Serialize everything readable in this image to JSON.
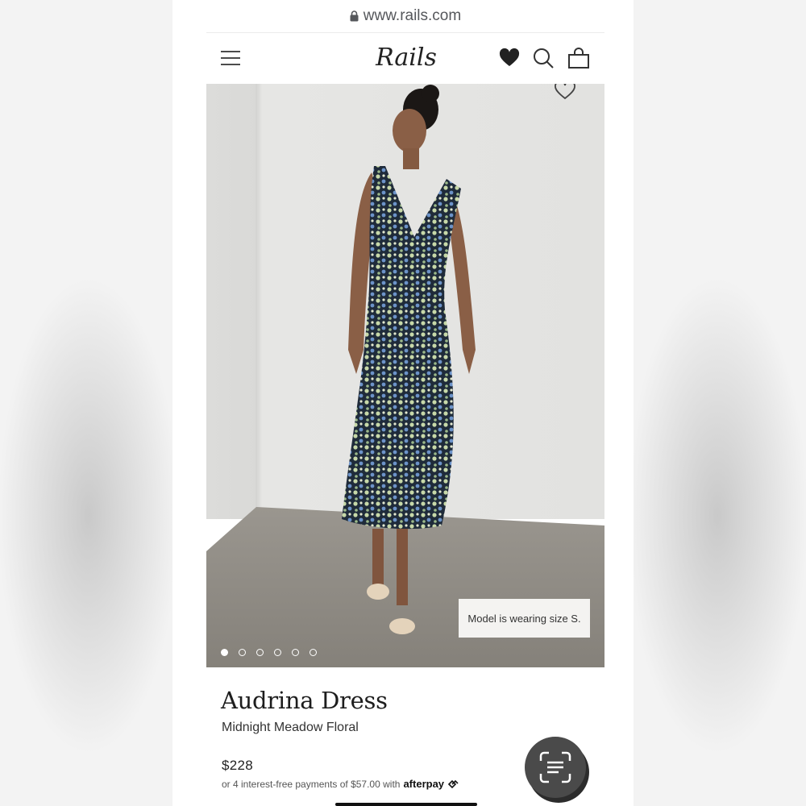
{
  "browser": {
    "url": "www.rails.com"
  },
  "header": {
    "brand": "Rails"
  },
  "hero": {
    "model_note": "Model is wearing size S.",
    "carousel": {
      "total": 6,
      "active_index": 0
    }
  },
  "product": {
    "name": "Audrina Dress",
    "color": "Midnight Meadow Floral",
    "price": "$228",
    "installments_text": "or 4 interest-free payments of $57.00 with",
    "afterpay_label": "afterpay"
  },
  "icons": {
    "menu": "menu-icon",
    "wishlist": "heart-icon",
    "search": "search-icon",
    "bag": "shopping-bag-icon",
    "favorite": "heart-outline-icon",
    "visual_search": "scan-icon"
  },
  "colors": {
    "text": "#1d1d1d",
    "accent": "#111111",
    "wall": "#e4e4e2",
    "floor": "#8f8b84"
  }
}
